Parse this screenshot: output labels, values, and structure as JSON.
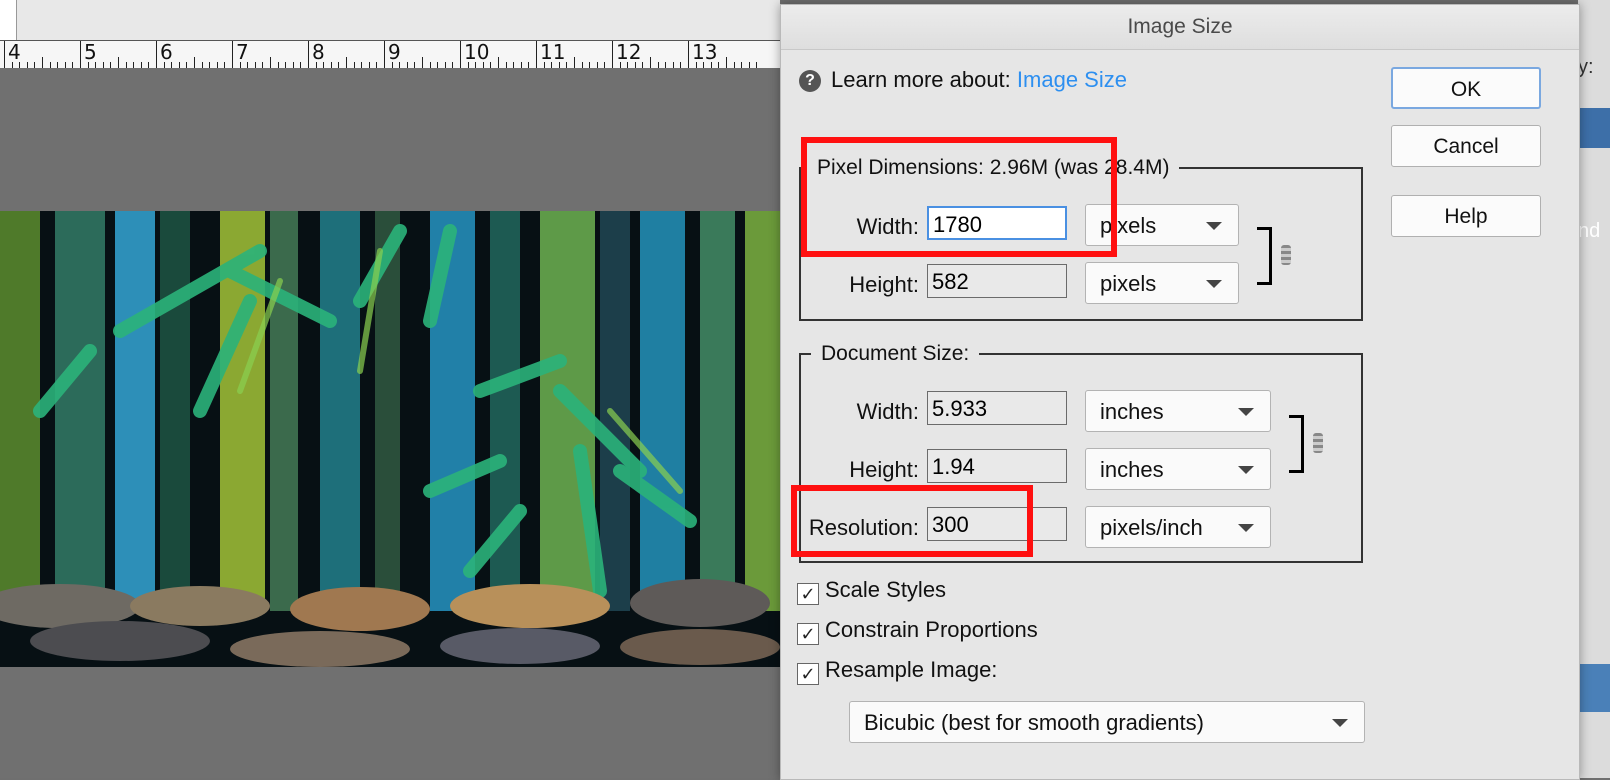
{
  "ruler": {
    "numbers": [
      "4",
      "5",
      "6",
      "7",
      "8",
      "9",
      "10",
      "11",
      "12",
      "13"
    ]
  },
  "dialog": {
    "title": "Image Size",
    "learn_prefix": "Learn more about:",
    "learn_link": "Image Size",
    "buttons": {
      "ok": "OK",
      "cancel": "Cancel",
      "help": "Help"
    },
    "pixel_dimensions": {
      "legend": "Pixel Dimensions:  2.96M (was 28.4M)",
      "width_label": "Width:",
      "width_value": "1780",
      "width_unit": "pixels",
      "height_label": "Height:",
      "height_value": "582",
      "height_unit": "pixels"
    },
    "document_size": {
      "legend": "Document Size:",
      "width_label": "Width:",
      "width_value": "5.933",
      "width_unit": "inches",
      "height_label": "Height:",
      "height_value": "1.94",
      "height_unit": "inches",
      "resolution_label": "Resolution:",
      "resolution_value": "300",
      "resolution_unit": "pixels/inch"
    },
    "options": {
      "scale_styles": "Scale Styles",
      "constrain_proportions": "Constrain Proportions",
      "resample_image": "Resample Image:",
      "resample_method": "Bicubic (best for smooth gradients)",
      "checked": [
        true,
        true,
        true
      ]
    }
  },
  "right_panel": {
    "label_partial": "y:",
    "button_partial": "nd"
  },
  "colors": {
    "highlight": "#ff1010",
    "link": "#2d8ff0",
    "canvas_bg": "#707070",
    "dialog_bg": "#e6e6e6"
  }
}
